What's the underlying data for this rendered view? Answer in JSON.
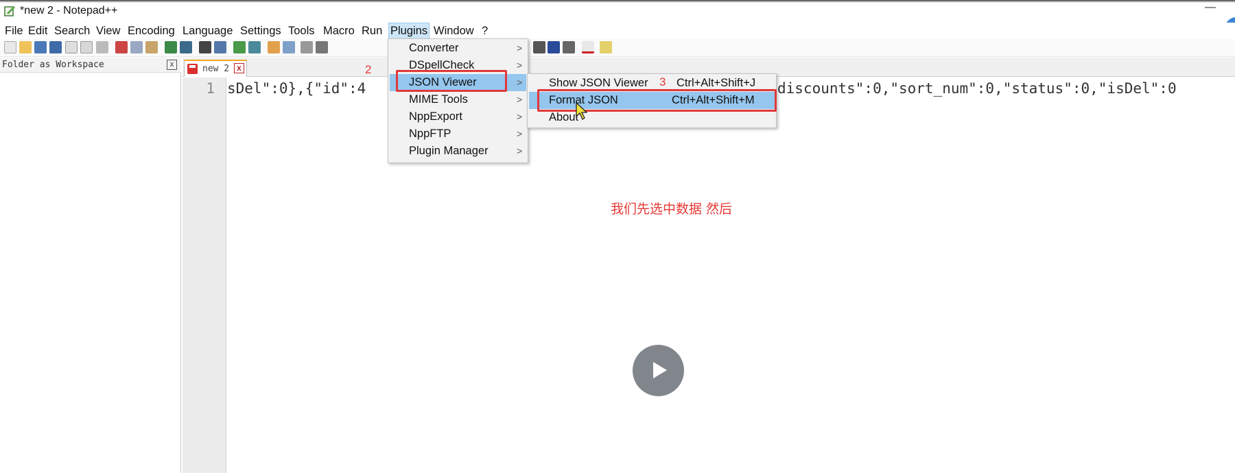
{
  "window": {
    "title": "*new 2 - Notepad++",
    "minimize_glyph": "—"
  },
  "menubar": {
    "items": [
      "File",
      "Edit",
      "Search",
      "View",
      "Encoding",
      "Language",
      "Settings",
      "Tools",
      "Macro",
      "Run",
      "Plugins",
      "Window",
      "?"
    ],
    "active": "Plugins"
  },
  "panel": {
    "title": "Folder as Workspace",
    "close_glyph": "x"
  },
  "tab": {
    "label": "new 2",
    "close_glyph": "x"
  },
  "editor": {
    "line_number": "1",
    "visible_text_left": "sDel\":0},{\"id\":4",
    "visible_text_right": "discounts\":0,\"sort_num\":0,\"status\":0,\"isDel\":0"
  },
  "plugins_menu": {
    "items": [
      {
        "label": "Converter",
        "has_submenu": true
      },
      {
        "label": "DSpellCheck",
        "has_submenu": true
      },
      {
        "label": "JSON Viewer",
        "has_submenu": true,
        "highlighted": true
      },
      {
        "label": "MIME Tools",
        "has_submenu": true
      },
      {
        "label": "NppExport",
        "has_submenu": true
      },
      {
        "label": "NppFTP",
        "has_submenu": true
      },
      {
        "label": "Plugin Manager",
        "has_submenu": true
      }
    ],
    "arrow_glyph": ">"
  },
  "json_viewer_submenu": {
    "items": [
      {
        "label": "Show JSON Viewer",
        "shortcut": "Ctrl+Alt+Shift+J"
      },
      {
        "label": "Format JSON",
        "shortcut": "Ctrl+Alt+Shift+M",
        "highlighted": true
      },
      {
        "label": "About",
        "shortcut": ""
      }
    ]
  },
  "annotations": {
    "step2": "2",
    "step3": "3",
    "subtitle": "我们先选中数据  然后"
  },
  "colors": {
    "annotation_red": "#e0393b",
    "highlight_blue": "#94c6ee",
    "tab_accent": "#f5a623"
  },
  "icons": [
    "notepad-app-icon",
    "play-icon",
    "pointer-cursor-icon",
    "save-icon",
    "close-icon",
    "submenu-arrow-icon"
  ]
}
